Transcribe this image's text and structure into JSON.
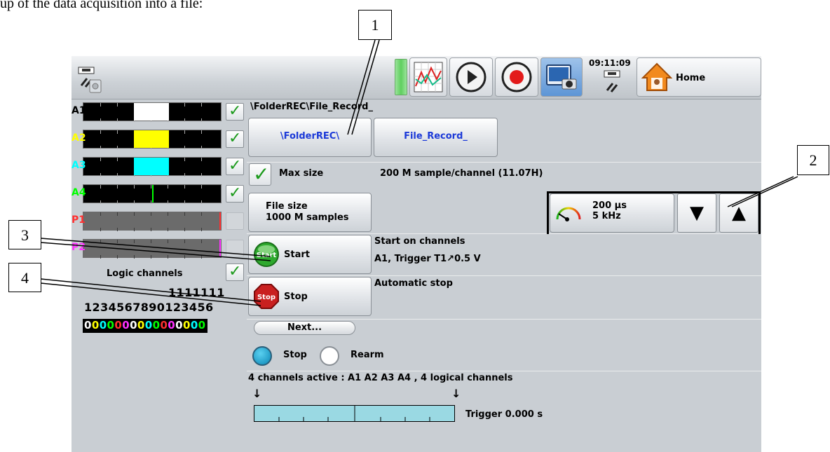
{
  "intro_text": "up of the data acquisition into a file:",
  "topbar": {
    "clock": "09:11:09",
    "home_label": "Home",
    "icons": [
      "usb-icon",
      "disk-icon",
      "battery-icon",
      "chart-icon",
      "play-icon",
      "record-icon",
      "screenshot-icon",
      "usb-icon",
      "home-icon"
    ]
  },
  "channels": [
    {
      "name": "A1",
      "color": "#ffffff",
      "enabled": true,
      "checked": true
    },
    {
      "name": "A2",
      "color": "#ffff00",
      "enabled": true,
      "checked": true
    },
    {
      "name": "A3",
      "color": "#00ffff",
      "enabled": true,
      "checked": true
    },
    {
      "name": "A4",
      "color": "#00ff00",
      "enabled": true,
      "checked": true
    },
    {
      "name": "P1",
      "color": "#ff3030",
      "enabled": false,
      "checked": false
    },
    {
      "name": "P2",
      "color": "#ff30ff",
      "enabled": false,
      "checked": false
    }
  ],
  "logic": {
    "label": "Logic channels",
    "tens_row": "1111111",
    "units_row": "1234567890123456",
    "bits": "0000000000000000",
    "bit_colors": [
      "#ffffff",
      "#ffff00",
      "#00ffff",
      "#00ff00",
      "#ff3030",
      "#ff30ff",
      "#ffffff",
      "#ffff00",
      "#00ffff",
      "#00ff00",
      "#ff3030",
      "#ff30ff",
      "#ffffff",
      "#ffff00",
      "#00ffff",
      "#00ff00"
    ]
  },
  "record": {
    "path": "\\FolderREC\\File_Record_",
    "folder_button": "\\FolderREC\\",
    "file_button": "File_Record_",
    "max_size_label": "Max size",
    "max_size_value": "200 M sample/channel (11.07H)",
    "file_size_line1": "File size",
    "file_size_line2": "1000 M samples",
    "sample_period": "200 µs",
    "sample_freq": "5 kHz",
    "down_arrow": "▼",
    "up_arrow": "▲",
    "start_button": "Start",
    "start_icon_text": "Start",
    "start_on_label": "Start on channels",
    "start_on_value": "A1, Trigger T1",
    "trigger_value": "0.5 V",
    "stop_button": "Stop",
    "stop_icon_text": "Stop",
    "auto_stop": "Automatic stop",
    "next_button": "Next...",
    "option_stop": "Stop",
    "option_rearm": "Rearm",
    "channels_active": "4 channels active : A1 A2 A3 A4 , 4 logical channels",
    "trigger_text": "Trigger 0.000 s"
  },
  "callouts": [
    "1",
    "2",
    "3",
    "4"
  ]
}
